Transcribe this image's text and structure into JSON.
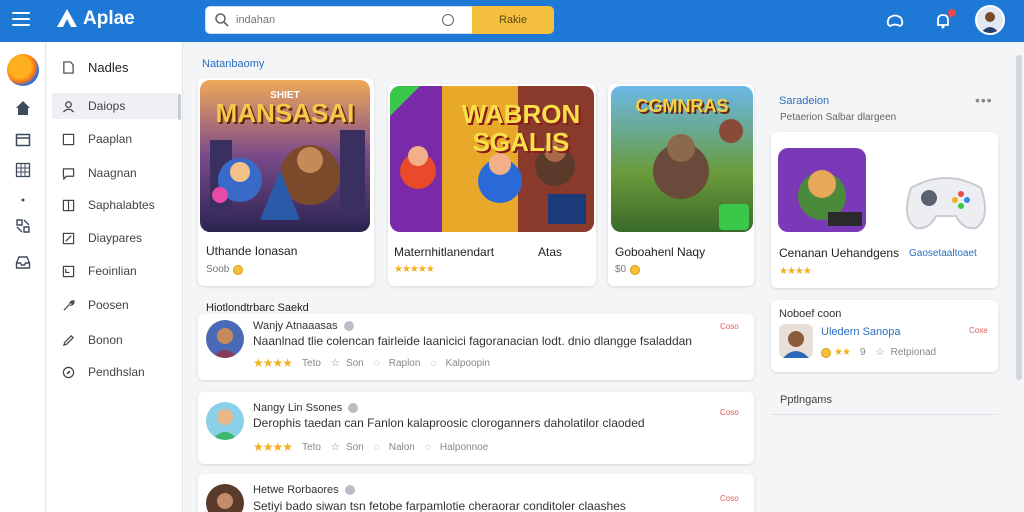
{
  "app": {
    "name": "Aplae"
  },
  "search": {
    "placeholder": "indahan",
    "button_label": "Rakie"
  },
  "sidebar": {
    "items": [
      {
        "label": "Nadles"
      },
      {
        "label": "Daiops"
      },
      {
        "label": "Paaplan"
      },
      {
        "label": "Naagnan"
      },
      {
        "label": "Saphalabtes"
      },
      {
        "label": "Diaypares"
      },
      {
        "label": "Feoinlian"
      },
      {
        "label": "Poosen"
      },
      {
        "label": "Bonon"
      },
      {
        "label": "Pendhslan"
      }
    ]
  },
  "featured": {
    "title": "Natanbaomy",
    "games": [
      {
        "art_text": "MANSASAI",
        "art_top": "SHIET",
        "title": "Uthande Ionasan",
        "sub": "Soob",
        "stars": ""
      },
      {
        "art_text": "WABRON SGALIS",
        "art_top": "",
        "title": "Maternhitlanendart",
        "sub": "",
        "stars": "★★★★★",
        "extra": "Atas"
      },
      {
        "art_text": "CGMNRAS",
        "art_top": "",
        "title": "Goboahenl Naqy",
        "sub": "$0",
        "stars": ""
      }
    ]
  },
  "reviews": {
    "title": "Hiotlondtrbarc Saekd",
    "items": [
      {
        "name": "Wanjy Atnaaasas",
        "text": "Naanlnad tlie colencan fairleide laanicici fagoranacian lodt. dnio dlangge fsaladdan",
        "stars": "★★★★",
        "meta": [
          "Teto",
          "Son",
          "Raplon",
          "Kalpoopin"
        ],
        "tag": "Coso"
      },
      {
        "name": "Nangy Lin Ssones",
        "text": "Derophis taedan can Fanlon kalaproosic cloroganners daholatilor claoded",
        "stars": "★★★★",
        "meta": [
          "Teto",
          "Son",
          "Nalon",
          "Halponnoe"
        ],
        "tag": "Coso"
      },
      {
        "name": "Hetwe Rorbaores",
        "text": "Setiyi bado siwan tsn fetobe farpamlotie cheraorar conditoler claashes",
        "stars": "",
        "meta": [],
        "tag": "Coso"
      }
    ]
  },
  "right_panel": {
    "title": "Saradeion",
    "more": "•••",
    "sub": "Petaerion Salbar dlargeen",
    "game_title": "Cenanan Uehandgens",
    "game_stars": "★★★★",
    "game_link": "Gaosetaaltoaet",
    "mini": {
      "title": "Noboef coon",
      "name": "Uledern Sanopa",
      "tag": "Coxe",
      "stars": "★★",
      "count": "9",
      "meta": "Retpionad"
    },
    "footer": "Pptlngams"
  },
  "colors": {
    "accent": "#1e78d6",
    "button": "#f5c040",
    "link": "#2a6fc0",
    "star": "#f2b01e"
  }
}
